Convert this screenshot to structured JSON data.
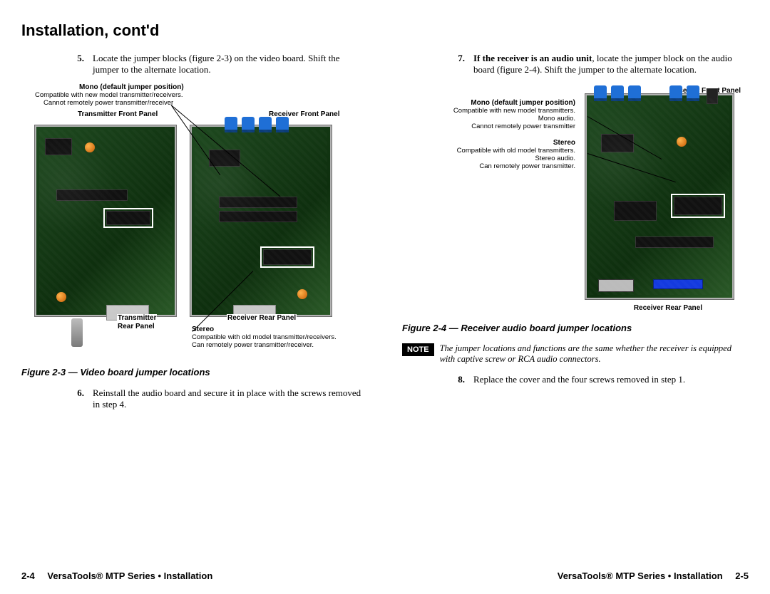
{
  "heading": "Installation, cont'd",
  "left": {
    "step5": {
      "num": "5.",
      "text": "Locate the jumper blocks (figure 2-3) on the video board. Shift the jumper to the alternate location."
    },
    "fig23_labels": {
      "mono_title": "Mono (default jumper position)",
      "mono_line1": "Compatible with new model transmitter/receivers.",
      "mono_line2": "Cannot remotely power transmitter/receiver",
      "tx_front": "Transmitter Front Panel",
      "rx_front": "Receiver Front Panel",
      "tx_rear1": "Transmitter",
      "tx_rear2": "Rear Panel",
      "rx_rear": "Receiver Rear Panel",
      "stereo_title": "Stereo",
      "stereo_line1": "Compatible with old model transmitter/receivers.",
      "stereo_line2": "Can remotely power transmitter/receiver."
    },
    "fig23_caption": "Figure 2-3 — Video board jumper locations",
    "step6": {
      "num": "6.",
      "text": "Reinstall the audio board and secure it in place with the screws removed in step 4."
    }
  },
  "right": {
    "step7": {
      "num": "7.",
      "lead": "If the receiver is an audio unit",
      "text": ", locate the jumper block on the audio board (figure 2-4).  Shift the jumper to the alternate location."
    },
    "fig24_labels": {
      "rx_front": "Receiver Front Panel",
      "mono_title": "Mono (default jumper position)",
      "mono_line1": "Compatible with new model transmitters.",
      "mono_line2": "Mono audio.",
      "mono_line3": "Cannot remotely power transmitter",
      "stereo_title": "Stereo",
      "stereo_line1": "Compatible with old model transmitters.",
      "stereo_line2": "Stereo audio.",
      "stereo_line3": "Can remotely power transmitter.",
      "rx_rear": "Receiver Rear Panel"
    },
    "fig24_caption": "Figure 2-4 — Receiver audio board jumper locations",
    "note_badge": "NOTE",
    "note_text": "The jumper locations and functions are the same whether the receiver is equipped with captive screw or RCA audio connectors.",
    "step8": {
      "num": "8.",
      "text": "Replace the cover and the four screws removed in step 1."
    }
  },
  "footer": {
    "left_page": "2-4",
    "left_text": "VersaTools® MTP Series • Installation",
    "right_text": "VersaTools® MTP Series • Installation",
    "right_page": "2-5"
  }
}
